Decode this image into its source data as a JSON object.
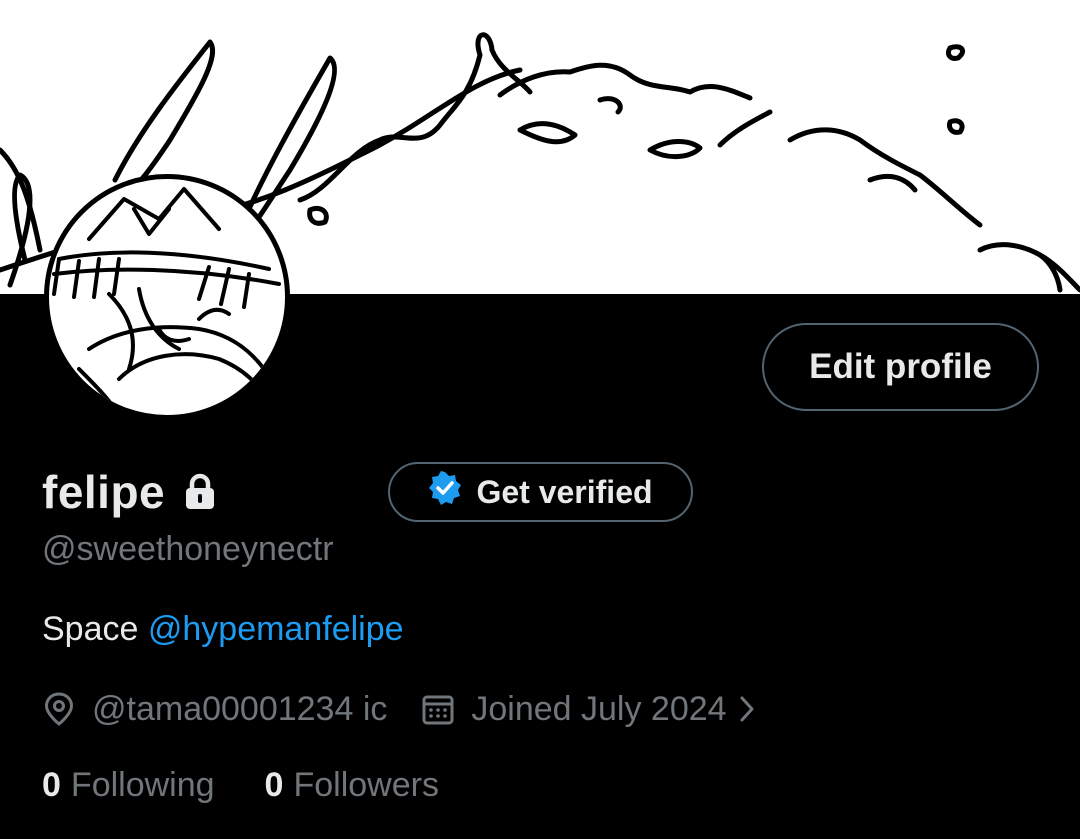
{
  "profile": {
    "display_name": "felipe",
    "handle": "@sweethoneynectr",
    "bio_text": "Space ",
    "bio_mention": "@hypemanfelipe",
    "location": "@tama00001234 ic",
    "joined": "Joined July 2024"
  },
  "buttons": {
    "edit_profile": "Edit profile",
    "get_verified": "Get verified"
  },
  "stats": {
    "following_count": "0",
    "following_label": "Following",
    "followers_count": "0",
    "followers_label": "Followers"
  },
  "icons": {
    "lock": "lock-icon",
    "verified": "verified-badge-icon",
    "location": "location-pin-icon",
    "calendar": "calendar-icon",
    "chevron": "chevron-right-icon"
  },
  "colors": {
    "background": "#000000",
    "text_primary": "#e7e9ea",
    "text_secondary": "#71767b",
    "link": "#1d9bf0",
    "button_border": "#536471"
  }
}
